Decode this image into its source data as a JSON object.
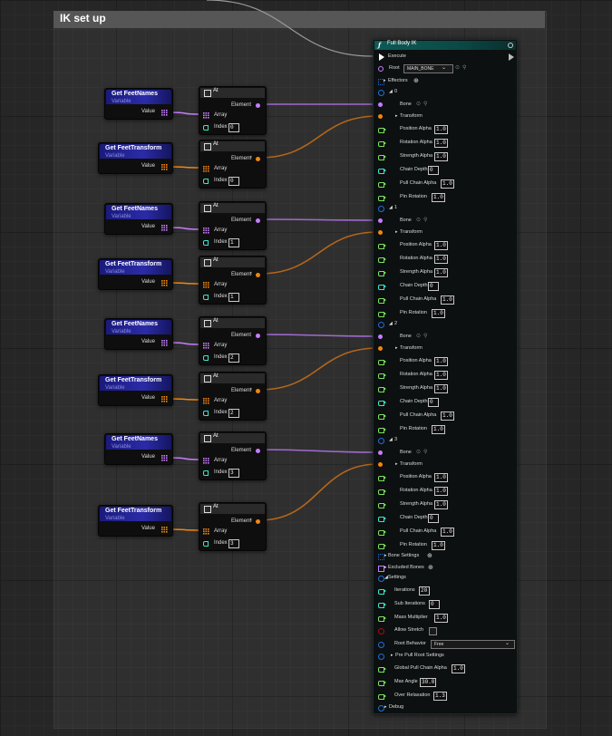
{
  "comment": {
    "title": "IK set up"
  },
  "var_nodes": [
    {
      "title": "Get FeetNames",
      "subtitle": "Variable",
      "pin_label": "Value",
      "kind": "names"
    },
    {
      "title": "Get FeetTransform",
      "subtitle": "Variable",
      "pin_label": "Value",
      "kind": "transform"
    },
    {
      "title": "Get FeetNames",
      "subtitle": "Variable",
      "pin_label": "Value",
      "kind": "names"
    },
    {
      "title": "Get FeetTransform",
      "subtitle": "Variable",
      "pin_label": "Value",
      "kind": "transform"
    },
    {
      "title": "Get FeetNames",
      "subtitle": "Variable",
      "pin_label": "Value",
      "kind": "names"
    },
    {
      "title": "Get FeetTransform",
      "subtitle": "Variable",
      "pin_label": "Value",
      "kind": "transform"
    },
    {
      "title": "Get FeetNames",
      "subtitle": "Variable",
      "pin_label": "Value",
      "kind": "names"
    },
    {
      "title": "Get FeetTransform",
      "subtitle": "Variable",
      "pin_label": "Value",
      "kind": "transform"
    }
  ],
  "at_nodes": [
    {
      "title": "At",
      "element_label": "Element",
      "array_label": "Array",
      "index_label": "Index",
      "index_value": "0",
      "kind": "names"
    },
    {
      "title": "At",
      "element_label": "Element",
      "array_label": "Array",
      "index_label": "Index",
      "index_value": "0",
      "kind": "transform"
    },
    {
      "title": "At",
      "element_label": "Element",
      "array_label": "Array",
      "index_label": "Index",
      "index_value": "1",
      "kind": "names"
    },
    {
      "title": "At",
      "element_label": "Element",
      "array_label": "Array",
      "index_label": "Index",
      "index_value": "1",
      "kind": "transform"
    },
    {
      "title": "At",
      "element_label": "Element",
      "array_label": "Array",
      "index_label": "Index",
      "index_value": "2",
      "kind": "names"
    },
    {
      "title": "At",
      "element_label": "Element",
      "array_label": "Array",
      "index_label": "Index",
      "index_value": "2",
      "kind": "transform"
    },
    {
      "title": "At",
      "element_label": "Element",
      "array_label": "Array",
      "index_label": "Index",
      "index_value": "3",
      "kind": "names"
    },
    {
      "title": "At",
      "element_label": "Element",
      "array_label": "Array",
      "index_label": "Index",
      "index_value": "3",
      "kind": "transform"
    }
  ],
  "fbik": {
    "title": "Full Body IK",
    "execute_label": "Execute",
    "root_label": "Root",
    "root_value": "MAIN_BONE",
    "effectors_label": "Effectors",
    "effectors": [
      {
        "index": "0",
        "bone": "Bone",
        "transform": "Transform",
        "position_alpha": "1.0",
        "rotation_alpha": "1.0",
        "strength_alpha": "1.0",
        "chain_depth": "0",
        "pull_chain_alpha": "1.0",
        "pin_rotation": "1.0"
      },
      {
        "index": "1",
        "bone": "Bone",
        "transform": "Transform",
        "position_alpha": "1.0",
        "rotation_alpha": "1.0",
        "strength_alpha": "1.0",
        "chain_depth": "0",
        "pull_chain_alpha": "1.0",
        "pin_rotation": "1.0"
      },
      {
        "index": "2",
        "bone": "Bone",
        "transform": "Transform",
        "position_alpha": "1.0",
        "rotation_alpha": "1.0",
        "strength_alpha": "1.0",
        "chain_depth": "0",
        "pull_chain_alpha": "1.0",
        "pin_rotation": "1.0"
      },
      {
        "index": "3",
        "bone": "Bone",
        "transform": "Transform",
        "position_alpha": "1.0",
        "rotation_alpha": "1.0",
        "strength_alpha": "1.0",
        "chain_depth": "0",
        "pull_chain_alpha": "1.0",
        "pin_rotation": "1.0"
      }
    ],
    "effector_labels": {
      "position_alpha": "Position Alpha",
      "rotation_alpha": "Rotation Alpha",
      "strength_alpha": "Strength Alpha",
      "chain_depth": "Chain Depth",
      "pull_chain_alpha": "Pull Chain Alpha",
      "pin_rotation": "Pin Rotation"
    },
    "bone_settings_label": "Bone Settings",
    "excluded_bones_label": "Excluded Bones",
    "settings_label": "Settings",
    "iterations_label": "Iterations",
    "iterations": "20",
    "sub_iterations_label": "Sub Iterations",
    "sub_iterations": "0",
    "mass_multiplier_label": "Mass Multiplier",
    "mass_multiplier": "1.0",
    "allow_stretch_label": "Allow Stretch",
    "root_behavior_label": "Root Behavior",
    "root_behavior": "Free",
    "pre_pull_label": "Pre Pull Root Settings",
    "global_pull_label": "Global Pull Chain Alpha",
    "global_pull": "1.0",
    "max_angle_label": "Max Angle",
    "max_angle": "30.0",
    "over_relaxation_label": "Over Relaxation",
    "over_relaxation": "1.3",
    "debug_label": "Debug"
  },
  "colors": {
    "name_pin": "#c77dff",
    "transform_pin": "#f2860c",
    "float_pin": "#7be35a",
    "int_pin": "#3ee6c9",
    "bool_pin": "#8b0000",
    "struct_pin": "#1e6fe0"
  }
}
